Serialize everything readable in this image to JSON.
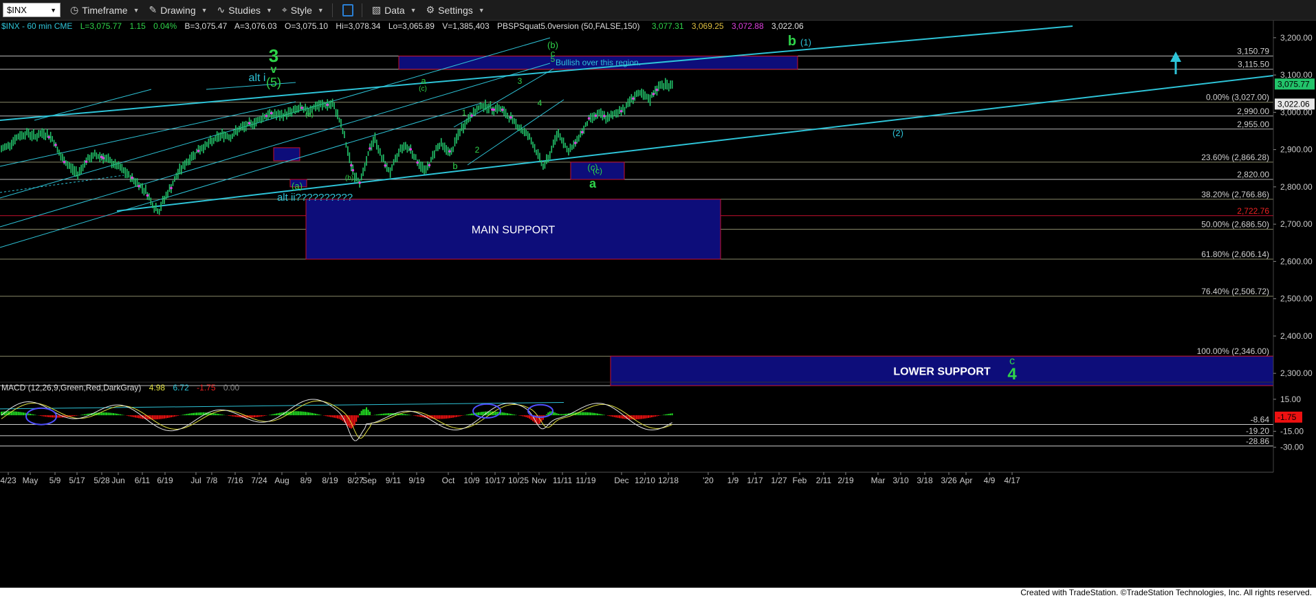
{
  "toolbar": {
    "symbol": "$INX",
    "timeframe": "Timeframe",
    "drawing": "Drawing",
    "studies": "Studies",
    "style": "Style",
    "data": "Data",
    "settings": "Settings"
  },
  "header": {
    "title": "$INX - 60 min  CME",
    "last": "L=3,075.77",
    "change": "1.15",
    "pct": "0.04%",
    "bid": "B=3,075.47",
    "ask": "A=3,076.03",
    "open": "O=3,075.10",
    "high": "Hi=3,078.34",
    "low": "Lo=3,065.89",
    "vol": "V=1,385,403",
    "study": "PBSPSquat5.0version (50,FALSE,150)",
    "v1": "3,077.31",
    "v2": "3,069.25",
    "v3": "3,072.88",
    "v4": "3,022.06"
  },
  "macd_header": {
    "label": "MACD (12,26,9,Green,Red,DarkGray)",
    "v1": "4.98",
    "v2": "6.72",
    "v3": "-1.75",
    "v4": "0.00"
  },
  "footer": "Created with TradeStation. ©TradeStation Technologies, Inc. All rights reserved.",
  "colors": {
    "price_bars": "#22c36a",
    "trend_lines": "#2ec4d8",
    "support_box": "#0d0d7a",
    "box_border": "#c8102e",
    "wave_label": "#2fd44a",
    "fib_text": "#d7d7d7",
    "last_price_bg": "#22c36a",
    "hist_pos": "#22dd22",
    "hist_neg": "#ee1111"
  },
  "chart_data": {
    "type": "line",
    "title": "$INX - 60 min",
    "x_ticks": [
      "4/23",
      "May",
      "5/9",
      "5/17",
      "5/28",
      "Jun",
      "6/11",
      "6/19",
      "Jul",
      "7/8",
      "7/16",
      "7/24",
      "Aug",
      "8/9",
      "8/19",
      "8/27",
      "Sep",
      "9/11",
      "9/19",
      "Oct",
      "10/9",
      "10/17",
      "10/25",
      "Nov",
      "11/11",
      "11/19",
      "Dec",
      "12/10",
      "12/18",
      "'20",
      "1/9",
      "1/17",
      "1/27",
      "Feb",
      "2/11",
      "2/19",
      "Mar",
      "3/10",
      "3/18",
      "3/26",
      "Apr",
      "4/9",
      "4/17"
    ],
    "y_ticks": [
      "3,200.00",
      "3,100.00",
      "3,000.00",
      "2,900.00",
      "2,800.00",
      "2,700.00",
      "2,600.00",
      "2,500.00",
      "2,400.00",
      "2,300.00"
    ],
    "ylim": [
      2280,
      3220
    ],
    "series": [
      {
        "values": [
          [
            0,
            2900
          ],
          [
            5,
            2915
          ],
          [
            10,
            2935
          ],
          [
            15,
            2945
          ],
          [
            20,
            2935
          ],
          [
            25,
            2945
          ],
          [
            30,
            2930
          ],
          [
            35,
            2880
          ],
          [
            40,
            2855
          ],
          [
            45,
            2835
          ],
          [
            50,
            2870
          ],
          [
            55,
            2885
          ],
          [
            60,
            2880
          ],
          [
            65,
            2865
          ],
          [
            70,
            2850
          ],
          [
            75,
            2830
          ],
          [
            80,
            2810
          ],
          [
            85,
            2790
          ],
          [
            90,
            2745
          ],
          [
            93,
            2735
          ],
          [
            95,
            2760
          ],
          [
            100,
            2800
          ],
          [
            105,
            2845
          ],
          [
            110,
            2870
          ],
          [
            115,
            2895
          ],
          [
            120,
            2910
          ],
          [
            125,
            2925
          ],
          [
            130,
            2940
          ],
          [
            135,
            2935
          ],
          [
            140,
            2955
          ],
          [
            145,
            2965
          ],
          [
            150,
            2975
          ],
          [
            155,
            2990
          ],
          [
            160,
            2995
          ],
          [
            165,
            2990
          ],
          [
            170,
            3000
          ],
          [
            175,
            3010
          ],
          [
            180,
            3005
          ],
          [
            185,
            3015
          ],
          [
            190,
            3020
          ],
          [
            195,
            3020
          ],
          [
            198,
            2995
          ],
          [
            202,
            2935
          ],
          [
            205,
            2875
          ],
          [
            208,
            2830
          ],
          [
            211,
            2815
          ],
          [
            214,
            2850
          ],
          [
            217,
            2905
          ],
          [
            220,
            2930
          ],
          [
            223,
            2890
          ],
          [
            226,
            2860
          ],
          [
            229,
            2840
          ],
          [
            232,
            2870
          ],
          [
            235,
            2905
          ],
          [
            238,
            2910
          ],
          [
            241,
            2900
          ],
          [
            244,
            2875
          ],
          [
            247,
            2855
          ],
          [
            250,
            2845
          ],
          [
            253,
            2870
          ],
          [
            256,
            2905
          ],
          [
            259,
            2915
          ],
          [
            262,
            2900
          ],
          [
            265,
            2890
          ],
          [
            268,
            2930
          ],
          [
            271,
            2955
          ],
          [
            274,
            2975
          ],
          [
            277,
            2995
          ],
          [
            280,
            3005
          ],
          [
            283,
            3020
          ],
          [
            286,
            3015
          ],
          [
            289,
            3010
          ],
          [
            292,
            3012
          ],
          [
            295,
            3005
          ],
          [
            298,
            2990
          ],
          [
            301,
            2980
          ],
          [
            304,
            2965
          ],
          [
            307,
            2950
          ],
          [
            310,
            2940
          ],
          [
            313,
            2915
          ],
          [
            316,
            2885
          ],
          [
            319,
            2855
          ],
          [
            322,
            2875
          ],
          [
            325,
            2915
          ],
          [
            328,
            2945
          ],
          [
            331,
            2920
          ],
          [
            334,
            2895
          ],
          [
            337,
            2910
          ],
          [
            340,
            2935
          ],
          [
            343,
            2955
          ],
          [
            346,
            2980
          ],
          [
            349,
            2990
          ],
          [
            352,
            2995
          ],
          [
            355,
            2988
          ],
          [
            358,
            2985
          ],
          [
            361,
            2995
          ],
          [
            364,
            3005
          ],
          [
            367,
            3010
          ],
          [
            370,
            3030
          ],
          [
            373,
            3045
          ],
          [
            376,
            3050
          ],
          [
            379,
            3040
          ],
          [
            382,
            3035
          ],
          [
            385,
            3060
          ],
          [
            388,
            3070
          ],
          [
            391,
            3075
          ],
          [
            394,
            3072
          ],
          [
            396,
            3076
          ]
        ]
      }
    ],
    "horizontal_levels": [
      {
        "value": 3150.79,
        "label": "3,150.79"
      },
      {
        "value": 3115.5,
        "label": "3,115.50"
      },
      {
        "value": 3027.0,
        "label": "0.00% (3,027.00)"
      },
      {
        "value": 2990.0,
        "label": "2,990.00"
      },
      {
        "value": 2955.0,
        "label": "2,955.00"
      },
      {
        "value": 2866.28,
        "label": "23.60% (2,866.28)"
      },
      {
        "value": 2820.0,
        "label": "2,820.00"
      },
      {
        "value": 2766.86,
        "label": "38.20% (2,766.86)"
      },
      {
        "value": 2722.76,
        "label": "2,722.76"
      },
      {
        "value": 2686.5,
        "label": "50.00% (2,686.50)"
      },
      {
        "value": 2606.14,
        "label": "61.80% (2,606.14)"
      },
      {
        "value": 2506.72,
        "label": "76.40% (2,506.72)"
      },
      {
        "value": 2346.0,
        "label": "100.00% (2,346.00)"
      },
      {
        "value": 2267.21,
        "label": "2,267.21"
      }
    ],
    "price_tags": [
      {
        "value": 3075.77,
        "label": "3,075.77"
      },
      {
        "value": 3022.06,
        "label": "3,022.06"
      }
    ],
    "boxes": [
      {
        "label": "Bullish over this region.",
        "x0": 580,
        "x1": 1160,
        "y0": 3115.5,
        "y1": 3150.79
      },
      {
        "label": "MAIN SUPPORT",
        "x0": 445,
        "x1": 1048,
        "y0": 2606.14,
        "y1": 2766.86
      },
      {
        "label": "LOWER SUPPORT",
        "x0": 888,
        "x1": 1914,
        "y0": 2267.21,
        "y1": 2346
      },
      {
        "label": "(c)",
        "x0": 830,
        "x1": 908,
        "y0": 2820,
        "y1": 2866.28
      },
      {
        "label": "",
        "x0": 398,
        "x1": 436,
        "y0": 2870,
        "y1": 2905
      },
      {
        "label": "",
        "x0": 422,
        "x1": 446,
        "y0": 2800,
        "y1": 2820
      }
    ],
    "annotations": [
      "3",
      "v",
      "(5)",
      "alt i",
      "alt ii??????????",
      "(a)",
      "(b)",
      "c",
      "b",
      "(1)",
      "(2)",
      "a",
      "(c)",
      "1",
      "2",
      "3",
      "4",
      "5",
      "(a)",
      "(c)",
      "(b)",
      "c",
      "4"
    ],
    "macd": {
      "label": "MACD (12,26,9,Green,Red,DarkGray)",
      "values": [
        4.98,
        6.72,
        -1.75,
        0.0
      ],
      "y_ticks": [
        "15.00",
        "-15.00",
        "-30.00"
      ],
      "levels": [
        {
          "value": -8.64,
          "label": "-8.64"
        },
        {
          "value": -19.2,
          "label": "-19.20"
        },
        {
          "value": -28.86,
          "label": "-28.86"
        }
      ],
      "last_tag": "-1.75",
      "ylim": [
        -36,
        22
      ]
    }
  }
}
